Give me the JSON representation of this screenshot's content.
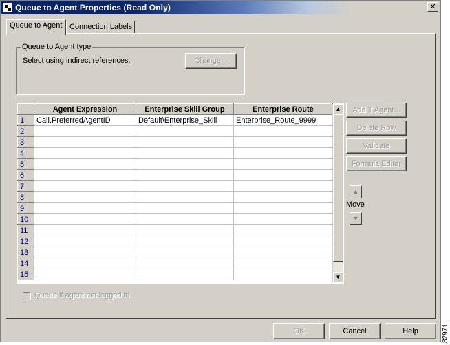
{
  "window": {
    "title": "Queue to Agent Properties (Read Only)",
    "close_glyph": "✕"
  },
  "tabs": [
    {
      "label": "Queue to Agent",
      "active": true
    },
    {
      "label": "Connection Labels",
      "active": false
    }
  ],
  "queue_type": {
    "group_label": "Queue to Agent type",
    "text": "Select using indirect references.",
    "change_label": "Change..."
  },
  "grid": {
    "columns": [
      "Agent Expression",
      "Enterprise Skill Group",
      "Enterprise Route"
    ],
    "rows": [
      {
        "num": "1",
        "cells": [
          "Call.PreferredAgentID",
          "Default\\Enterprise_Skill",
          "Enterprise_Route_9999"
        ]
      },
      {
        "num": "2",
        "cells": [
          "",
          "",
          ""
        ]
      },
      {
        "num": "3",
        "cells": [
          "",
          "",
          ""
        ]
      },
      {
        "num": "4",
        "cells": [
          "",
          "",
          ""
        ]
      },
      {
        "num": "5",
        "cells": [
          "",
          "",
          ""
        ]
      },
      {
        "num": "6",
        "cells": [
          "",
          "",
          ""
        ]
      },
      {
        "num": "7",
        "cells": [
          "",
          "",
          ""
        ]
      },
      {
        "num": "8",
        "cells": [
          "",
          "",
          ""
        ]
      },
      {
        "num": "9",
        "cells": [
          "",
          "",
          ""
        ]
      },
      {
        "num": "10",
        "cells": [
          "",
          "",
          ""
        ]
      },
      {
        "num": "11",
        "cells": [
          "",
          "",
          ""
        ]
      },
      {
        "num": "12",
        "cells": [
          "",
          "",
          ""
        ]
      },
      {
        "num": "13",
        "cells": [
          "",
          "",
          ""
        ]
      },
      {
        "num": "14",
        "cells": [
          "",
          "",
          ""
        ]
      },
      {
        "num": "15",
        "cells": [
          "",
          "",
          ""
        ]
      }
    ]
  },
  "side_buttons": {
    "add_agent": "Add T Agent...",
    "delete_row": "Delete Row",
    "validate": "Validate",
    "formula_editor": "Formula Editor",
    "move_label": "Move"
  },
  "checkbox": {
    "label": "Queue if agent not logged in",
    "checked": false
  },
  "footer": {
    "ok": "OK",
    "cancel": "Cancel",
    "help": "Help"
  },
  "figure_id": "82971",
  "colors": {
    "title_bar": "#0a246a",
    "face": "#d4d0c8",
    "row_number": "#000080"
  }
}
